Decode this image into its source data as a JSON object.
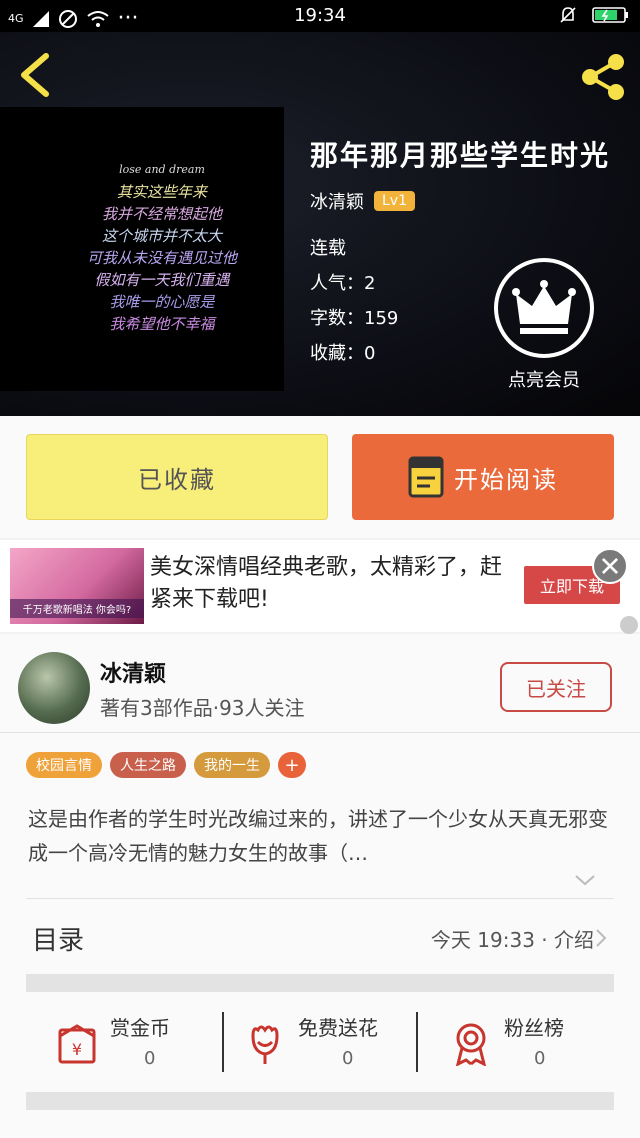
{
  "status_bar": {
    "network": "4G",
    "time": "19:34",
    "dots": "···"
  },
  "book": {
    "title": "那年那月那些学生时光",
    "author": "冰清颖",
    "level": "Lv1",
    "status": "连载",
    "popularity": "人气：2",
    "word_count": "字数：159",
    "favorites": "收藏：0",
    "cover_lines": [
      "lose and dream",
      "其实这些年来",
      "我并不经常想起他",
      "这个城市并不太大",
      "可我从未没有遇见过他",
      "假如有一天我们重遇",
      "我唯一的心愿是",
      "我希望他不幸福"
    ],
    "vip_label": "点亮会员"
  },
  "actions": {
    "collect_label": "已收藏",
    "read_label": "开始阅读"
  },
  "ad": {
    "image_caption": "千万老歌新唱法 你会吗?",
    "text": "美女深情唱经典老歌，太精彩了，赶紧来下载吧!",
    "button": "立即下载"
  },
  "author_card": {
    "name": "冰清颖",
    "stats": "著有3部作品·93人关注",
    "follow_label": "已关注",
    "tags": [
      {
        "label": "校园言情",
        "color": "#f0a23a"
      },
      {
        "label": "人生之路",
        "color": "#c8604c"
      },
      {
        "label": "我的一生",
        "color": "#d49a3c"
      }
    ],
    "tag_add": "+",
    "synopsis": "这是由作者的学生时光改编过来的，讲述了一个少女从天真无邪变成一个高冷无情的魅力女生的故事（…"
  },
  "toc": {
    "label": "目录",
    "meta": "今天 19:33 · 介绍"
  },
  "stats": [
    {
      "label": "赏金币",
      "count": "0",
      "icon": "red-envelope-icon"
    },
    {
      "label": "免费送花",
      "count": "0",
      "icon": "flower-icon"
    },
    {
      "label": "粉丝榜",
      "count": "0",
      "icon": "medal-icon"
    }
  ],
  "colors": {
    "accent": "#ea6a3c",
    "collect": "#f8ee7a",
    "icon_red": "#c8352e"
  }
}
